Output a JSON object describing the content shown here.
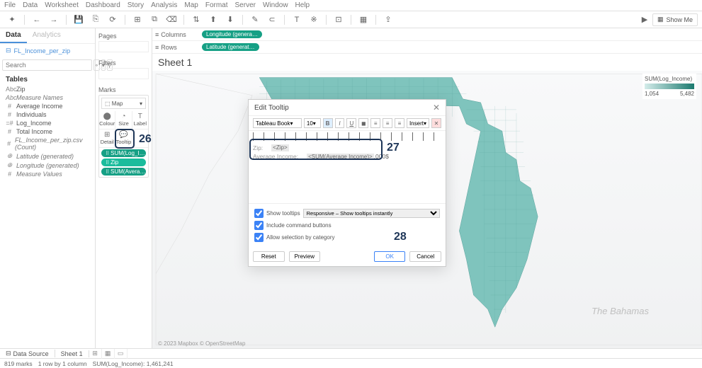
{
  "menubar": [
    "File",
    "Data",
    "Worksheet",
    "Dashboard",
    "Story",
    "Analysis",
    "Map",
    "Format",
    "Server",
    "Window",
    "Help"
  ],
  "toolbar": {
    "showme": "Show Me"
  },
  "leftPanel": {
    "tabs": {
      "data": "Data",
      "analytics": "Analytics"
    },
    "connection": "FL_Income_per_zip",
    "searchPlaceholder": "Search",
    "tablesHeader": "Tables",
    "fields": [
      {
        "ico": "Abc",
        "label": "Zip"
      },
      {
        "ico": "Abc",
        "label": "Measure Names",
        "italic": true
      },
      {
        "ico": "#",
        "label": "Average Income"
      },
      {
        "ico": "#",
        "label": "Individuals"
      },
      {
        "ico": "=#",
        "label": "Log_Income"
      },
      {
        "ico": "#",
        "label": "Total Income"
      },
      {
        "ico": "#",
        "label": "FL_Income_per_zip.csv (Count)",
        "italic": true
      },
      {
        "ico": "⊕",
        "label": "Latitude (generated)",
        "italic": true
      },
      {
        "ico": "⊕",
        "label": "Longitude (generated)",
        "italic": true
      },
      {
        "ico": "#",
        "label": "Measure Values",
        "italic": true
      }
    ]
  },
  "midPanel": {
    "pages": "Pages",
    "filters": "Filters",
    "marks": "Marks",
    "markType": "Map",
    "cells": {
      "colour": "Colour",
      "size": "Size",
      "label": "Label",
      "detail": "Detail",
      "tooltip": "Tooltip"
    },
    "pills": [
      "SUM(Log_I…",
      "Zip",
      "SUM(Avera…"
    ]
  },
  "shelves": {
    "columns": "Columns",
    "rows": "Rows",
    "colPill": "Longitude (genera…",
    "rowPill": "Latitude (generat…"
  },
  "sheetTitle": "Sheet 1",
  "legend": {
    "title": "SUM(Log_Income)",
    "min": "1,054",
    "max": "5,482"
  },
  "credit": "© 2023 Mapbox © OpenStreetMap",
  "bahamas": "The Bahamas",
  "modal": {
    "title": "Edit Tooltip",
    "font": "Tableau Book",
    "fontSize": "10",
    "insert": "Insert",
    "line1": {
      "k": "Zip:",
      "v": "<Zip>"
    },
    "line2": {
      "k": "Average Income:",
      "v": "<SUM(Average Income)>",
      "suffix": ",000$"
    },
    "showTooltips": "Show tooltips",
    "tooltipMode": "Responsive – Show tooltips instantly",
    "includeCmd": "Include command buttons",
    "allowSel": "Allow selection by category",
    "reset": "Reset",
    "preview": "Preview",
    "ok": "OK",
    "cancel": "Cancel"
  },
  "annotations": {
    "a26": "26",
    "a27": "27",
    "a28": "28"
  },
  "tabbar": {
    "dataSource": "Data Source",
    "sheet": "Sheet 1"
  },
  "status": {
    "marks": "819 marks",
    "rows": "1 row by 1 column",
    "sum": "SUM(Log_Income): 1,461,241"
  }
}
